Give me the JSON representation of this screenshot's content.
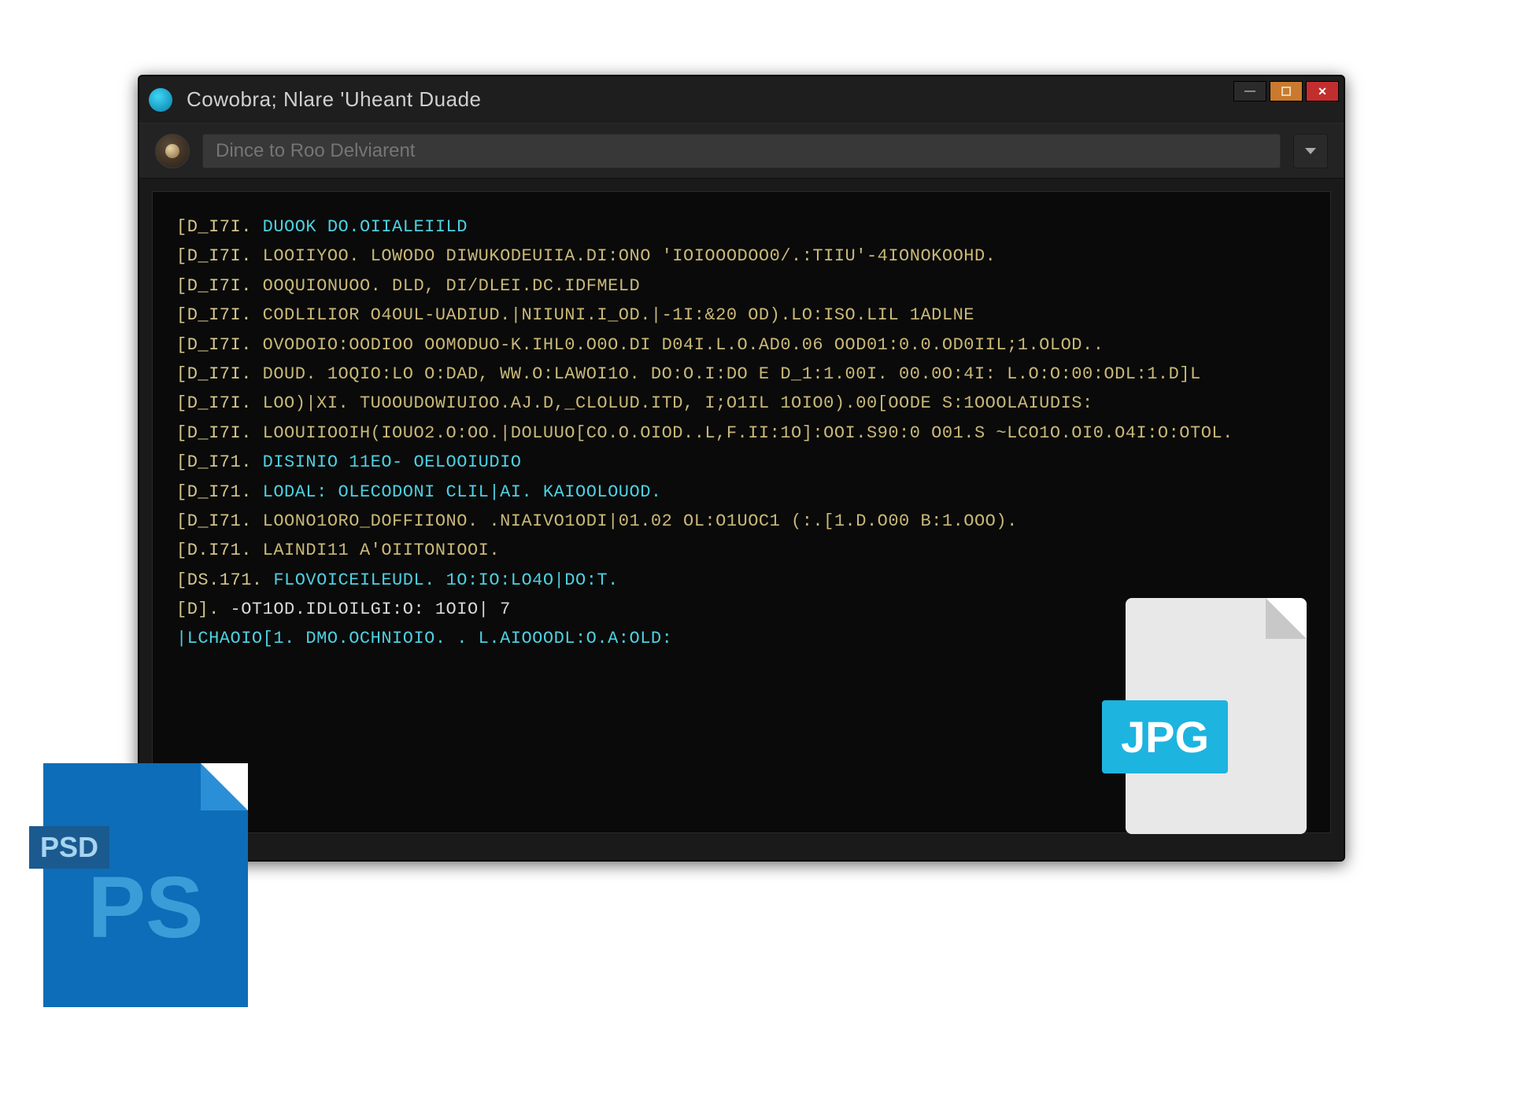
{
  "window": {
    "title": "Cowobra; Nlare 'Uheant Duade"
  },
  "toolbar": {
    "search_placeholder": "Dince to Roo Delviarent"
  },
  "console": {
    "lines": [
      {
        "tag": "[D_I7I.",
        "text": "DUOOK DO.OIIALEIILD",
        "color": "cyan"
      },
      {
        "tag": "[D_I7I.",
        "text": "LOOIIYOO. LOWODO DIWUKODEUIIA.DI:ONO 'IOIOOODOO0/.:TIIU'-4IONOKOOHD.",
        "color": "tan"
      },
      {
        "tag": "[D_I7I.",
        "text": "OOQUIONUOO. DLD, DI/DLEI.DC.IDFMELD",
        "color": "tan"
      },
      {
        "tag": "[D_I7I.",
        "text": "CODLILIOR O4OUL-UADIUD.|NIIUNI.I_OD.|-1I:&20 OD).LO:ISO.LIL 1ADLNE",
        "color": "tan"
      },
      {
        "tag": "[D_I7I.",
        "text": "OVODOIO:OODIOO OOMODUO-K.IHL0.O0O.DI D04I.L.O.AD0.06 OOD01:0.0.OD0IIL;1.OLOD..",
        "color": "tan"
      },
      {
        "tag": "[D_I7I.",
        "text": "DOUD. 1OQIO:LO O:DAD,  WW.O:LAWOI1O. DO:O.I:DO E D_1:1.00I. 00.0O:4I: L.O:O:00:ODL:1.D]L",
        "color": "tan"
      },
      {
        "tag": "[D_I7I.",
        "text": "LOO)|XI. TUOOUDOWIUIOO.AJ.D,_CLOLUD.ITD, I;O1IL 1OIO0).00[OODE S:1OOOLAIUDIS:",
        "color": "tan"
      },
      {
        "tag": "[D_I7I.",
        "text": "LOOUIIOOIH(IOUO2.O:OO.|DOLUUO[CO.O.OIOD..L,F.II:1O]:OOI.S90:0 O01.S ~LCO1O.OI0.O4I:O:OTOL.",
        "color": "tan"
      },
      {
        "tag": "[D_I71.",
        "text": "DISINIO 11EO- OELOOIUDIO",
        "color": "cyan"
      },
      {
        "tag": "[D_I71.",
        "text": "LODAL: OLECODONI CLIL|AI. KAIOOLOUOD.",
        "color": "cyan"
      },
      {
        "tag": "[D_I71.",
        "text": "LOONO1ORO_DOFFIIONO. .NIAIVO1ODI|01.02 OL:O1UOC1 (:.[1.D.O00 B:1.OOO).",
        "color": "tan"
      },
      {
        "tag": "[D.I71.",
        "text": "LAINDI11 A'OIITONIOOI.",
        "color": "tan"
      },
      {
        "tag": "[DS.171.",
        "text": "FLOVOICEILEUDL. 1O:IO:LO4O|DO:T.",
        "color": "cyan"
      },
      {
        "tag": "[D].",
        "text": "-OT1OD.IDLOILGI:O: 1OIO| 7",
        "color": "white"
      },
      {
        "tag": "",
        "text": "|LCHAOIO[1.  DMO.OCHNIOIO. . L.AIOOODL:O.A:OLD:",
        "color": "cyan"
      }
    ]
  },
  "file_icons": {
    "psd": {
      "label": "PSD",
      "big": "PS"
    },
    "jpg": {
      "label": "JPG"
    }
  }
}
